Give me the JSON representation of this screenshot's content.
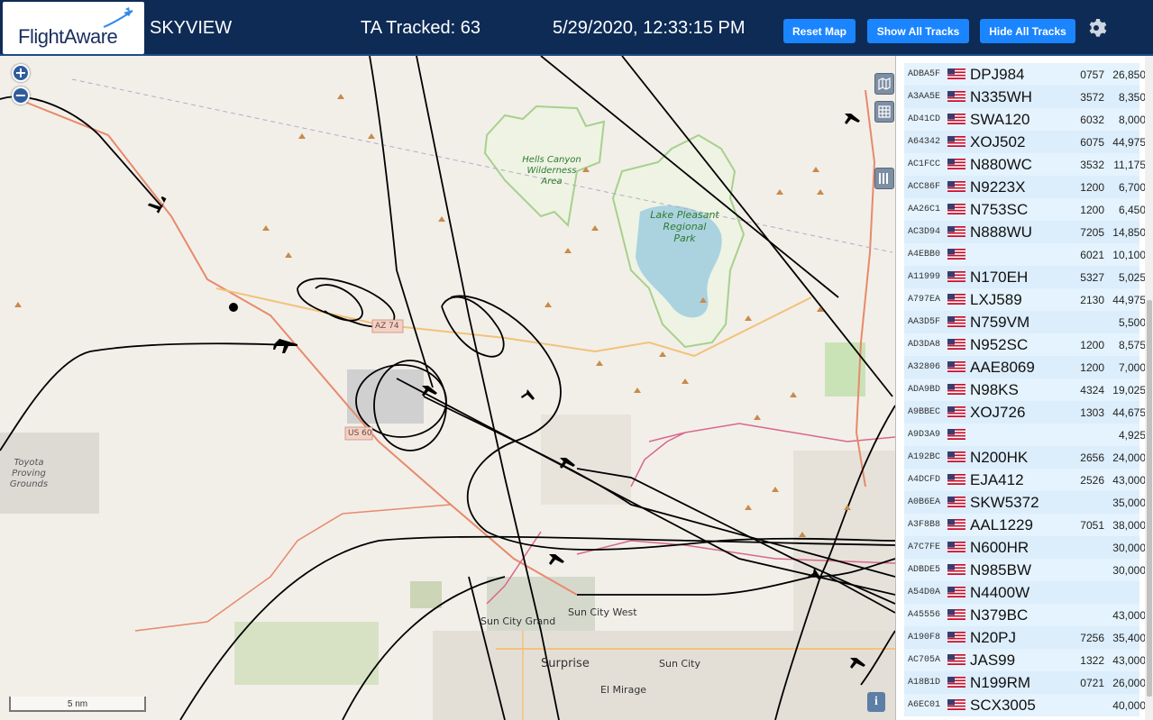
{
  "header": {
    "logo_text": "FlightAware",
    "site_name": "SKYVIEW",
    "tracked": "TA Tracked: 63",
    "datetime": "5/29/2020, 12:33:15 PM",
    "reset_label": "Reset Map",
    "show_label": "Show All Tracks",
    "hide_label": "Hide All Tracks"
  },
  "map": {
    "labels": {
      "hells_canyon": [
        "Hells Canyon",
        "Wilderness",
        "Area"
      ],
      "lake_pleasant": [
        "Lake Pleasant",
        "Regional",
        "Park"
      ],
      "toyota": [
        "Toyota",
        "Proving",
        "Grounds"
      ],
      "az74": "AZ 74",
      "us60": "US 60",
      "sun_city_grand": "Sun City Grand",
      "sun_city_west": "Sun City West",
      "surprise": "Surprise",
      "sun_city": "Sun City",
      "el_mirage": "El Mirage"
    },
    "scale_label": "5 nm",
    "zoom_in": "+",
    "zoom_out": "−",
    "info": "i"
  },
  "aircraft": [
    {
      "hex": "ADBA5F",
      "callsign": "DPJ984",
      "squawk": "0757",
      "altitude": "26,850",
      "trend": "▲"
    },
    {
      "hex": "A3AA5E",
      "callsign": "N335WH",
      "squawk": "3572",
      "altitude": "8,350",
      "trend": "▼"
    },
    {
      "hex": "AD41CD",
      "callsign": "SWA120",
      "squawk": "6032",
      "altitude": "8,000",
      "trend": "▼"
    },
    {
      "hex": "A64342",
      "callsign": "XOJ502",
      "squawk": "6075",
      "altitude": "44,975",
      "trend": ""
    },
    {
      "hex": "AC1FCC",
      "callsign": "N880WC",
      "squawk": "3532",
      "altitude": "11,175",
      "trend": "▼"
    },
    {
      "hex": "ACC86F",
      "callsign": "N9223X",
      "squawk": "1200",
      "altitude": "6,700",
      "trend": "▼"
    },
    {
      "hex": "AA26C1",
      "callsign": "N753SC",
      "squawk": "1200",
      "altitude": "6,450",
      "trend": ""
    },
    {
      "hex": "AC3D94",
      "callsign": "N888WU",
      "squawk": "7205",
      "altitude": "14,850",
      "trend": "▼"
    },
    {
      "hex": "A4EBB0",
      "callsign": "",
      "squawk": "6021",
      "altitude": "10,100",
      "trend": ""
    },
    {
      "hex": "A11999",
      "callsign": "N170EH",
      "squawk": "5327",
      "altitude": "5,025",
      "trend": ""
    },
    {
      "hex": "A797EA",
      "callsign": "LXJ589",
      "squawk": "2130",
      "altitude": "44,975",
      "trend": ""
    },
    {
      "hex": "AA3D5F",
      "callsign": "N759VM",
      "squawk": "",
      "altitude": "5,500",
      "trend": ""
    },
    {
      "hex": "AD3DA8",
      "callsign": "N952SC",
      "squawk": "1200",
      "altitude": "8,575",
      "trend": ""
    },
    {
      "hex": "A32806",
      "callsign": "AAE8069",
      "squawk": "1200",
      "altitude": "7,000",
      "trend": "▲"
    },
    {
      "hex": "ADA9BD",
      "callsign": "N98KS",
      "squawk": "4324",
      "altitude": "19,025",
      "trend": ""
    },
    {
      "hex": "A9BBEC",
      "callsign": "XOJ726",
      "squawk": "1303",
      "altitude": "44,675",
      "trend": "▲"
    },
    {
      "hex": "A9D3A9",
      "callsign": "",
      "squawk": "",
      "altitude": "4,925",
      "trend": "▲"
    },
    {
      "hex": "A192BC",
      "callsign": "N200HK",
      "squawk": "2656",
      "altitude": "24,000",
      "trend": ""
    },
    {
      "hex": "A4DCFD",
      "callsign": "EJA412",
      "squawk": "2526",
      "altitude": "43,000",
      "trend": ""
    },
    {
      "hex": "A0B6EA",
      "callsign": "SKW5372",
      "squawk": "",
      "altitude": "35,000",
      "trend": ""
    },
    {
      "hex": "A3F8B8",
      "callsign": "AAL1229",
      "squawk": "7051",
      "altitude": "38,000",
      "trend": ""
    },
    {
      "hex": "A7C7FE",
      "callsign": "N600HR",
      "squawk": "",
      "altitude": "30,000",
      "trend": ""
    },
    {
      "hex": "ADBDE5",
      "callsign": "N985BW",
      "squawk": "",
      "altitude": "30,000",
      "trend": ""
    },
    {
      "hex": "A54D0A",
      "callsign": "N4400W",
      "squawk": "",
      "altitude": "",
      "trend": ""
    },
    {
      "hex": "A45556",
      "callsign": "N379BC",
      "squawk": "",
      "altitude": "43,000",
      "trend": ""
    },
    {
      "hex": "A190F8",
      "callsign": "N20PJ",
      "squawk": "7256",
      "altitude": "35,400",
      "trend": "▲"
    },
    {
      "hex": "AC705A",
      "callsign": "JAS99",
      "squawk": "1322",
      "altitude": "43,000",
      "trend": ""
    },
    {
      "hex": "A18B1D",
      "callsign": "N199RM",
      "squawk": "0721",
      "altitude": "26,000",
      "trend": ""
    },
    {
      "hex": "A6EC01",
      "callsign": "SCX3005",
      "squawk": "",
      "altitude": "40,000",
      "trend": ""
    }
  ],
  "colors": {
    "header_bg": "#0e2b55",
    "button": "#1a85ff",
    "row_bg": "#e1f2fd",
    "track": "#000000",
    "highway": "#e8896b",
    "park_border": "#a8d08d",
    "lake": "#aad3df"
  }
}
